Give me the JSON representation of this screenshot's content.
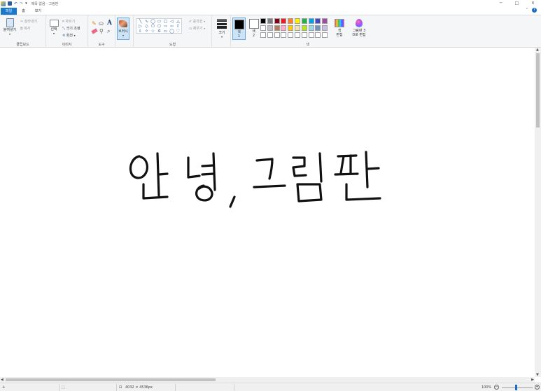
{
  "window": {
    "title": "제목 없음 - 그림판",
    "controls": {
      "minimize": "─",
      "maximize": "□",
      "close": "✕"
    }
  },
  "tabs": [
    {
      "label": "파일"
    },
    {
      "label": "홈"
    },
    {
      "label": "보기"
    }
  ],
  "ribbon_controls": {
    "collapse": "⌃",
    "help": "?"
  },
  "clipboard": {
    "paste": "붙여넣기",
    "cut": "잘라내기",
    "copy": "복사",
    "group_label": "클립보드"
  },
  "image": {
    "select": "선택",
    "crop": "자르기",
    "resize": "크기 조정",
    "rotate": "회전",
    "group_label": "이미지"
  },
  "tools": {
    "group_label": "도구",
    "text_tool": "A"
  },
  "brushes": {
    "label": "브러시"
  },
  "shapes": {
    "group_label": "도형",
    "outline": "윤곽선",
    "fill": "채우기",
    "glyphs": [
      "╲",
      "∿",
      "◯",
      "▭",
      "▢",
      "◁",
      "△",
      "▷",
      "◇",
      "⬠",
      "⬡",
      "⇨",
      "⇦",
      "⇧",
      "⇩",
      "✧",
      "☆",
      "✡",
      "▭",
      "◯",
      "♡"
    ]
  },
  "size": {
    "label": "크기"
  },
  "colors": {
    "color1_label": "색\n1",
    "color2_label": "색\n2",
    "color1_value": "#000000",
    "color2_value": "#ffffff",
    "edit_colors": "색\n편집",
    "paint3d": "그림판 3\nD로 편집",
    "group_label": "색",
    "palette": [
      "#000000",
      "#7f7f7f",
      "#880015",
      "#ed1c24",
      "#ff7f27",
      "#fff200",
      "#22b14c",
      "#00a2e8",
      "#3f48cc",
      "#a349a4",
      "#ffffff",
      "#c3c3c3",
      "#b97a57",
      "#ffaec9",
      "#ffc90e",
      "#efe4b0",
      "#b5e61d",
      "#99d9ea",
      "#7092be",
      "#c8bfe7",
      "#ffffff",
      "#ffffff",
      "#ffffff",
      "#ffffff",
      "#ffffff",
      "#ffffff",
      "#ffffff",
      "#ffffff",
      "#ffffff",
      "#ffffff"
    ]
  },
  "canvas": {
    "handwriting": "안녕, 그림판"
  },
  "status": {
    "image_size": "4032 × 4536px",
    "zoom": "100%"
  }
}
